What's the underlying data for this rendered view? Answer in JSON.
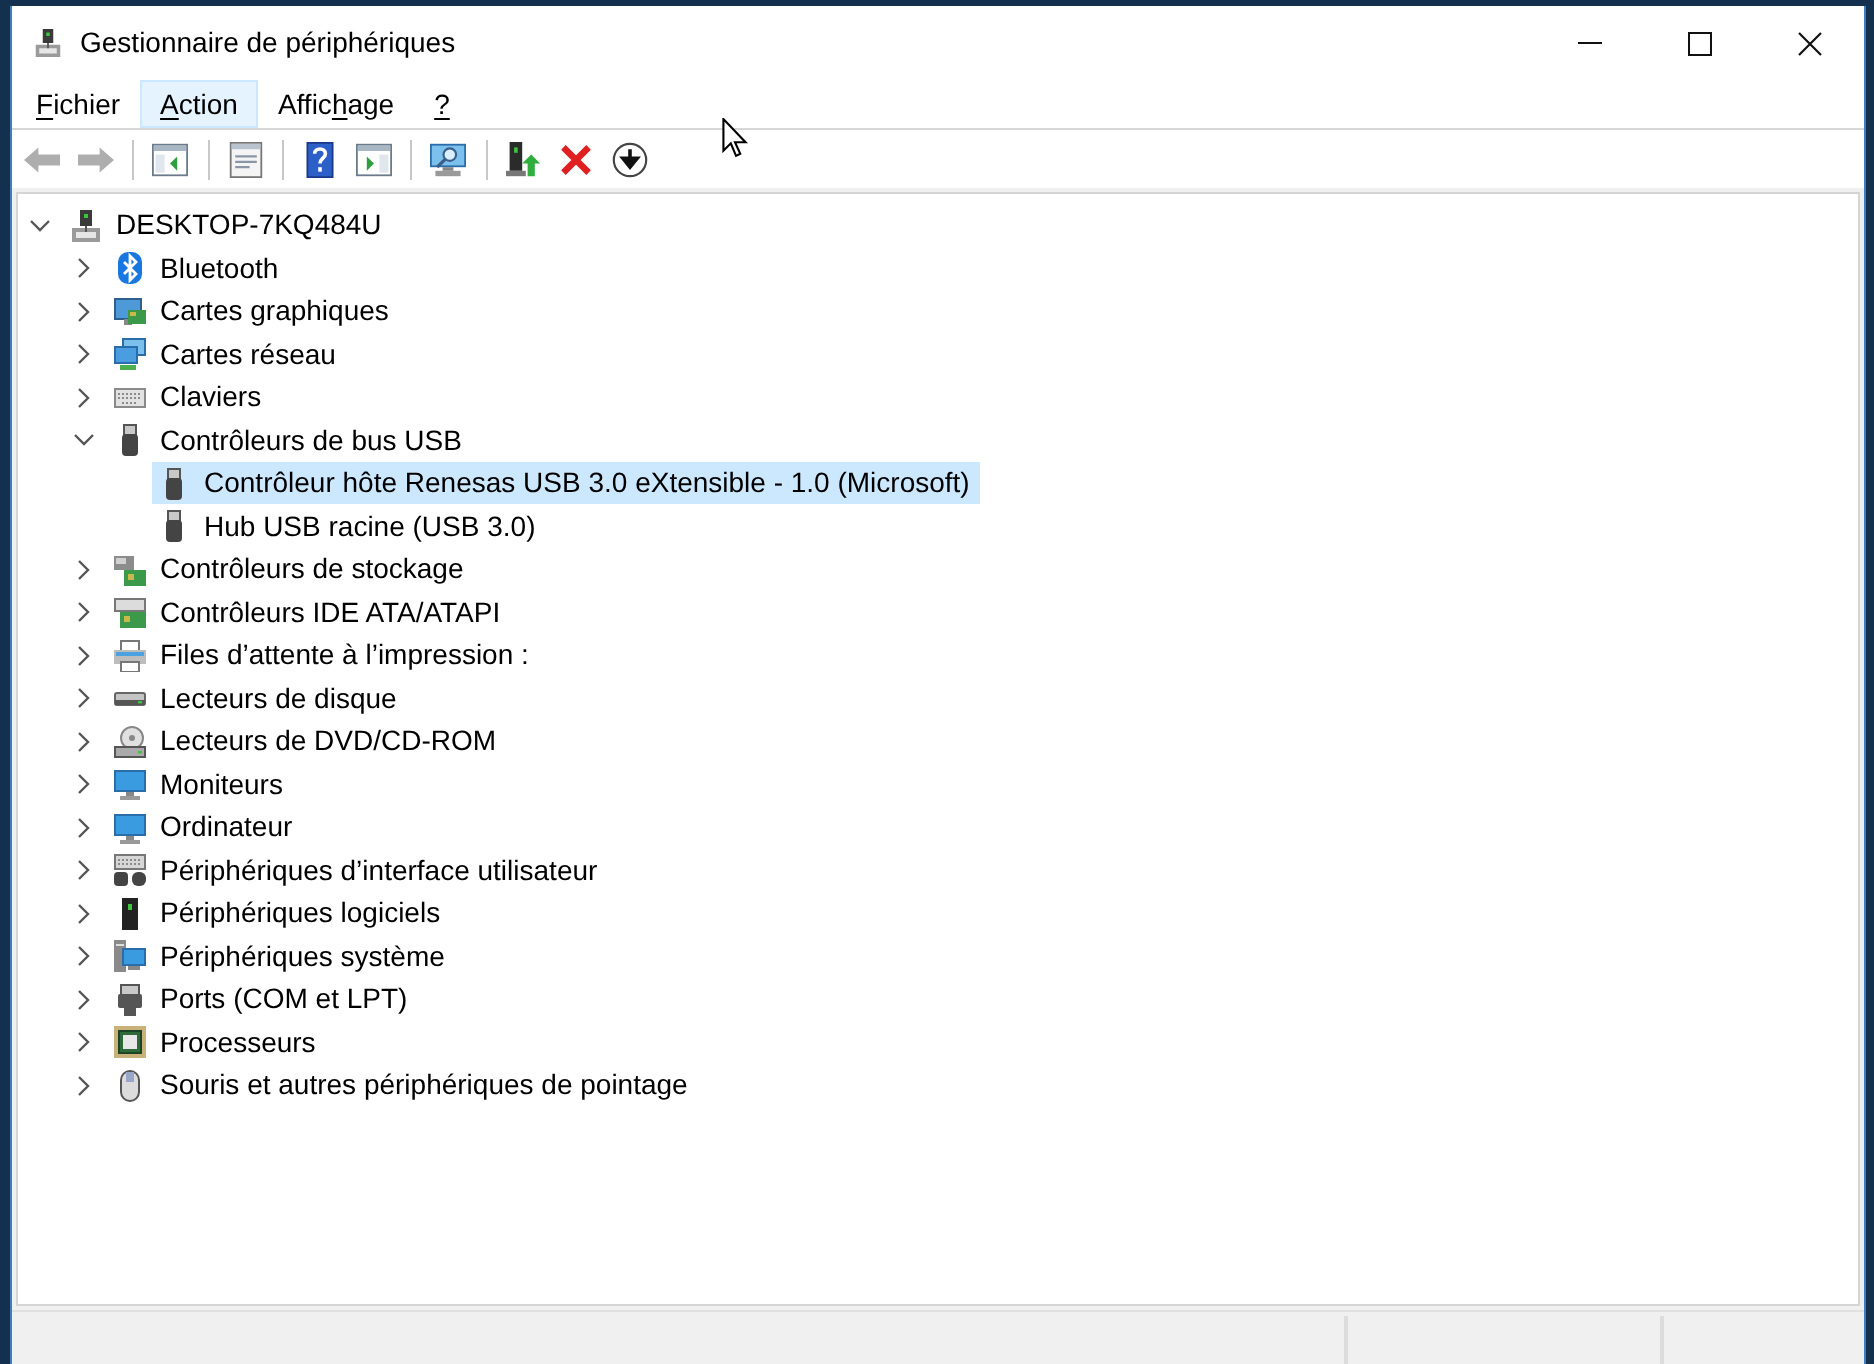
{
  "window": {
    "title": "Gestionnaire de périphériques"
  },
  "menu": [
    {
      "parts": [
        {
          "text": "F",
          "underline": true
        },
        {
          "text": "ichier",
          "underline": false
        }
      ],
      "highlighted": false
    },
    {
      "parts": [
        {
          "text": "A",
          "underline": true
        },
        {
          "text": "ction",
          "underline": false
        }
      ],
      "highlighted": true
    },
    {
      "parts": [
        {
          "text": "Affic",
          "underline": false
        },
        {
          "text": "h",
          "underline": true
        },
        {
          "text": "age",
          "underline": false
        }
      ],
      "highlighted": false
    },
    {
      "parts": [
        {
          "text": "?",
          "underline": true
        }
      ],
      "highlighted": false
    }
  ],
  "toolbar": {
    "groups": [
      [
        {
          "kind": "back",
          "disabled": true
        },
        {
          "kind": "forward",
          "disabled": true
        }
      ],
      [
        {
          "kind": "console-tree",
          "disabled": false
        }
      ],
      [
        {
          "kind": "properties",
          "disabled": false
        }
      ],
      [
        {
          "kind": "help",
          "disabled": false
        },
        {
          "kind": "action-pane",
          "disabled": false
        }
      ],
      [
        {
          "kind": "scan",
          "disabled": false
        }
      ],
      [
        {
          "kind": "update-driver",
          "disabled": false
        },
        {
          "kind": "uninstall",
          "disabled": false
        },
        {
          "kind": "disable",
          "disabled": false
        }
      ]
    ]
  },
  "tree": [
    {
      "label": "DESKTOP-7KQ484U",
      "kind": "host",
      "expanded": true,
      "selected": false,
      "children": [
        {
          "label": "Bluetooth",
          "kind": "bluetooth",
          "expanded": false,
          "selected": false
        },
        {
          "label": "Cartes graphiques",
          "kind": "display-adapter",
          "expanded": false,
          "selected": false
        },
        {
          "label": "Cartes réseau",
          "kind": "network",
          "expanded": false,
          "selected": false
        },
        {
          "label": "Claviers",
          "kind": "keyboard",
          "expanded": false,
          "selected": false
        },
        {
          "label": "Contrôleurs de bus USB",
          "kind": "usb",
          "expanded": true,
          "selected": false,
          "children": [
            {
              "label": "Contrôleur hôte Renesas USB 3.0 eXtensible - 1.0 (Microsoft)",
              "kind": "usb",
              "selected": true
            },
            {
              "label": "Hub USB racine (USB 3.0)",
              "kind": "usb",
              "selected": false
            }
          ]
        },
        {
          "label": "Contrôleurs de stockage",
          "kind": "storage",
          "expanded": false,
          "selected": false
        },
        {
          "label": "Contrôleurs IDE ATA/ATAPI",
          "kind": "ide",
          "expanded": false,
          "selected": false
        },
        {
          "label": "Files d’attente à l’impression :",
          "kind": "printer",
          "expanded": false,
          "selected": false
        },
        {
          "label": "Lecteurs de disque",
          "kind": "disk",
          "expanded": false,
          "selected": false
        },
        {
          "label": "Lecteurs de DVD/CD-ROM",
          "kind": "dvd",
          "expanded": false,
          "selected": false
        },
        {
          "label": "Moniteurs",
          "kind": "monitor",
          "expanded": false,
          "selected": false
        },
        {
          "label": "Ordinateur",
          "kind": "monitor",
          "expanded": false,
          "selected": false
        },
        {
          "label": "Périphériques d’interface utilisateur",
          "kind": "hid",
          "expanded": false,
          "selected": false
        },
        {
          "label": "Périphériques logiciels",
          "kind": "software",
          "expanded": false,
          "selected": false
        },
        {
          "label": "Périphériques système",
          "kind": "system",
          "expanded": false,
          "selected": false
        },
        {
          "label": "Ports (COM et LPT)",
          "kind": "ports",
          "expanded": false,
          "selected": false
        },
        {
          "label": "Processeurs",
          "kind": "processor",
          "expanded": false,
          "selected": false
        },
        {
          "label": "Souris et autres périphériques de pointage",
          "kind": "mouse",
          "expanded": false,
          "selected": false
        }
      ]
    }
  ]
}
